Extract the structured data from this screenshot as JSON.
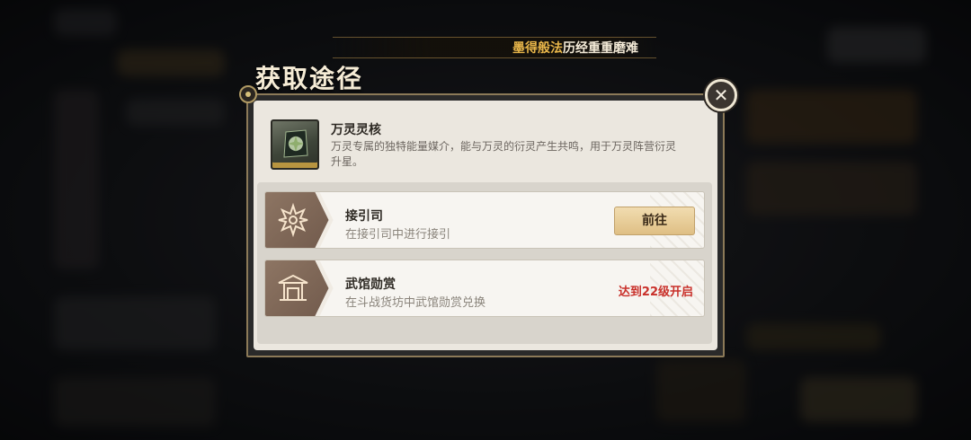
{
  "banner": {
    "highlight": "墨得般法",
    "text": "历经重重磨难"
  },
  "dialog": {
    "title": "获取途径",
    "close_icon": "close-icon"
  },
  "item": {
    "name": "万灵灵核",
    "description": "万灵专属的独特能量媒介，能与万灵的衍灵产生共鸣，用于万灵阵营衍灵升星。",
    "icon": "crystal-core-icon"
  },
  "sources": [
    {
      "title": "接引司",
      "subtitle": "在接引司中进行接引",
      "icon": "lotus-icon",
      "action_label": "前往"
    },
    {
      "title": "武馆勋赏",
      "subtitle": "在斗战货坊中武馆勋赏兑换",
      "icon": "pavilion-icon",
      "lock_label": "达到22级开启"
    }
  ],
  "colors": {
    "accent_gold": "#e8b64a",
    "lock_red": "#c9302a",
    "tab_brown": "#7e6656"
  }
}
